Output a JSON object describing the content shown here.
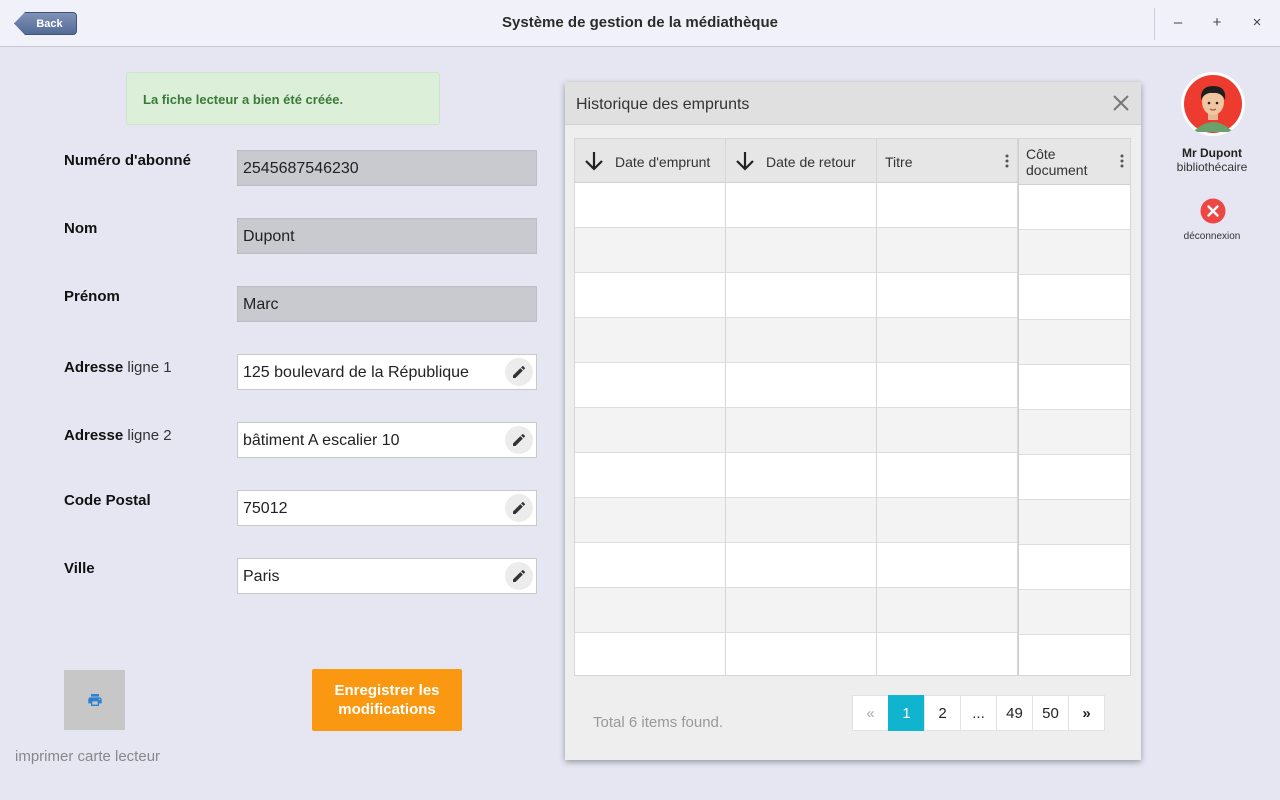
{
  "window": {
    "title": "Système de gestion de la médiathèque",
    "back_label": "Back",
    "minimize_glyph": "–",
    "maximize_glyph": "+",
    "close_glyph": "×"
  },
  "alert": {
    "text": "La fiche lecteur a bien été créée."
  },
  "form": {
    "subscriber_number": {
      "label": "Numéro d'abonné",
      "value": "2545687546230"
    },
    "last_name": {
      "label": "Nom",
      "value": "Dupont"
    },
    "first_name": {
      "label": "Prénom",
      "value": "Marc"
    },
    "address1": {
      "label_bold": "Adresse",
      "label_rest": " ligne 1",
      "value": "125 boulevard de la République"
    },
    "address2": {
      "label_bold": "Adresse",
      "label_rest": " ligne 2",
      "value": "bâtiment A escalier 10"
    },
    "postal_code": {
      "label": "Code Postal",
      "value": "75012"
    },
    "city": {
      "label": "Ville",
      "value": "Paris"
    }
  },
  "actions": {
    "print_label": "imprimer carte lecteur",
    "save_label_line1": "Enregistrer les",
    "save_label_line2": "modifications"
  },
  "history": {
    "title": "Historique des emprunts",
    "columns": {
      "loan_date": "Date d'emprunt",
      "return_date": "Date de retour",
      "title": "Titre",
      "doc_code_line1": "Côte",
      "doc_code_line2": "document"
    },
    "total_text": "Total 6 items found.",
    "pagination": {
      "first": "«",
      "pages": [
        "1",
        "2",
        "...",
        "49",
        "50"
      ],
      "next": "»",
      "active_page": "1"
    }
  },
  "user": {
    "name": "Mr Dupont",
    "role": "bibliothécaire",
    "logout_label": "déconnexion"
  },
  "colors": {
    "accent_orange": "#fb9811",
    "page_active": "#10b4cf",
    "alert_bg": "#dcefd9",
    "alert_text": "#3a7a3a",
    "logout_red": "#ee4545"
  }
}
